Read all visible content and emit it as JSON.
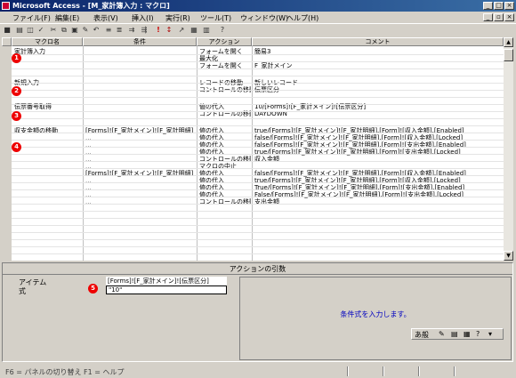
{
  "window": {
    "title": "Microsoft Access - [M_家計簿入力 : マクロ]"
  },
  "menu": [
    "ファイル(F)",
    "編集(E)",
    "表示(V)",
    "挿入(I)",
    "実行(R)",
    "ツール(T)",
    "ウィンドウ(W)",
    "ヘルプ(H)"
  ],
  "columns": {
    "macro_name": "マクロ名",
    "condition": "条件",
    "action": "アクション",
    "comment": "コメント"
  },
  "rows": [
    {
      "name": "家計簿入力",
      "cond": "",
      "action": "フォームを開く",
      "comment": "簡易3"
    },
    {
      "name": "",
      "cond": "",
      "action": "最大化",
      "comment": ""
    },
    {
      "name": "",
      "cond": "",
      "action": "フォームを開く",
      "comment": "F_家計メイン"
    },
    {
      "name": "新規入力",
      "cond": "",
      "action": "レコードの移動",
      "comment": "新しいレコード"
    },
    {
      "name": "",
      "cond": "",
      "action": "コントロールの移動",
      "comment": "伝票区分"
    },
    {
      "name": "伝票番号取得",
      "cond": "",
      "action": "値の代入",
      "comment": "10/[Forms]![F_家計メイン]![伝票区分]"
    },
    {
      "name": "",
      "cond": "",
      "action": "コントロールの移動",
      "comment": "DAYDOWN"
    },
    {
      "name": "収支金額の移動",
      "cond": "[Forms]![F_家計メイン]![F_家計明細]",
      "action": "値の代入",
      "comment": "true/[Forms]![F_家計メイン]![F_家計明細].[Form]![収入金額].[Enabled]"
    },
    {
      "name": "",
      "cond": "...",
      "action": "値の代入",
      "comment": "false/[Forms]![F_家計メイン]![F_家計明細].[Form]![収入金額].[Locked]"
    },
    {
      "name": "",
      "cond": "...",
      "action": "値の代入",
      "comment": "false/[Forms]![F_家計メイン]![F_家計明細].[Form]![支出金額].[Enabled]"
    },
    {
      "name": "",
      "cond": "...",
      "action": "値の代入",
      "comment": "true/[Forms]![F_家計メイン]![F_家計明細].[Form]![支出金額].[Locked]"
    },
    {
      "name": "",
      "cond": "...",
      "action": "コントロールの移動",
      "comment": "収入金額"
    },
    {
      "name": "",
      "cond": "...",
      "action": "マクロの中止",
      "comment": ""
    },
    {
      "name": "",
      "cond": "[Forms]![F_家計メイン]![F_家計明細]",
      "action": "値の代入",
      "comment": "false/[Forms]![F_家計メイン]![F_家計明細].[Form]![収入金額].[Enabled]"
    },
    {
      "name": "",
      "cond": "...",
      "action": "値の代入",
      "comment": "true/[Forms]![F_家計メイン]![F_家計明細].[Form]![収入金額].[Locked]"
    },
    {
      "name": "",
      "cond": "...",
      "action": "値の代入",
      "comment": "True/[Forms]![F_家計メイン]![F_家計明細].[Form]![支出金額].[Enabled]"
    },
    {
      "name": "",
      "cond": "...",
      "action": "値の代入",
      "comment": "False/[Forms]![F_家計メイン]![F_家計明細].[Form]![支出金額].[Locked]"
    },
    {
      "name": "",
      "cond": "...",
      "action": "コントロールの移動",
      "comment": "支出金額"
    }
  ],
  "badges": [
    "1",
    "2",
    "3",
    "4",
    "5"
  ],
  "args": {
    "header": "アクションの引数",
    "item_label": "アイテム",
    "item_value": "[Forms]![F_家計メイン]![伝票区分]",
    "expr_label": "式",
    "expr_value": "\"10\"",
    "help": "条件式を入力します。",
    "ime": "あ般"
  },
  "status": {
    "text": "F6 = パネルの切り替え   F1 = ヘルプ"
  },
  "colors": {
    "title_start": "#0a246a",
    "title_end": "#3a6ea5",
    "badge": "#e00000",
    "help_text": "#0000c0"
  }
}
